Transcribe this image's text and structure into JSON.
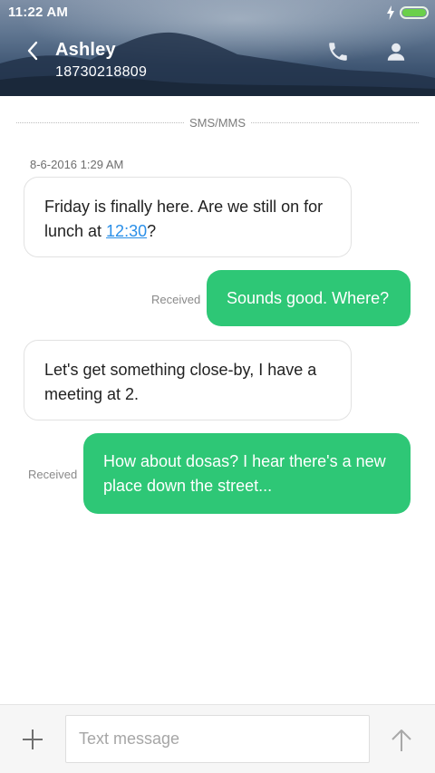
{
  "status_bar": {
    "time": "11:22 AM",
    "icons": [
      "charging-icon",
      "battery-icon"
    ],
    "battery_level": 1.0,
    "battery_color": "#6ad04a"
  },
  "header": {
    "contact_name": "Ashley",
    "contact_number": "18730218809",
    "icons": [
      "back-arrow-icon",
      "phone-icon",
      "person-icon"
    ]
  },
  "conversation": {
    "channel_label": "SMS/MMS",
    "timestamp": "8-6-2016 1:29 AM",
    "messages": [
      {
        "direction": "incoming",
        "text_before": "Friday is finally here. Are we still on for lunch at ",
        "link": "12:30",
        "text_after": "?"
      },
      {
        "direction": "outgoing",
        "status": "Received",
        "text": "Sounds good. Where?"
      },
      {
        "direction": "incoming",
        "text": "Let's get something close-by, I have a meeting at 2."
      },
      {
        "direction": "outgoing",
        "status": "Received",
        "text": "How about dosas? I hear there's a new place down the street..."
      }
    ]
  },
  "composer": {
    "placeholder": "Text message",
    "value": "",
    "icons": [
      "plus-icon",
      "send-arrow-icon"
    ]
  },
  "colors": {
    "outgoing_bubble": "#2ec776",
    "incoming_bubble": "#ffffff",
    "link": "#2a8fe8",
    "header_bg": "#3f5673"
  }
}
